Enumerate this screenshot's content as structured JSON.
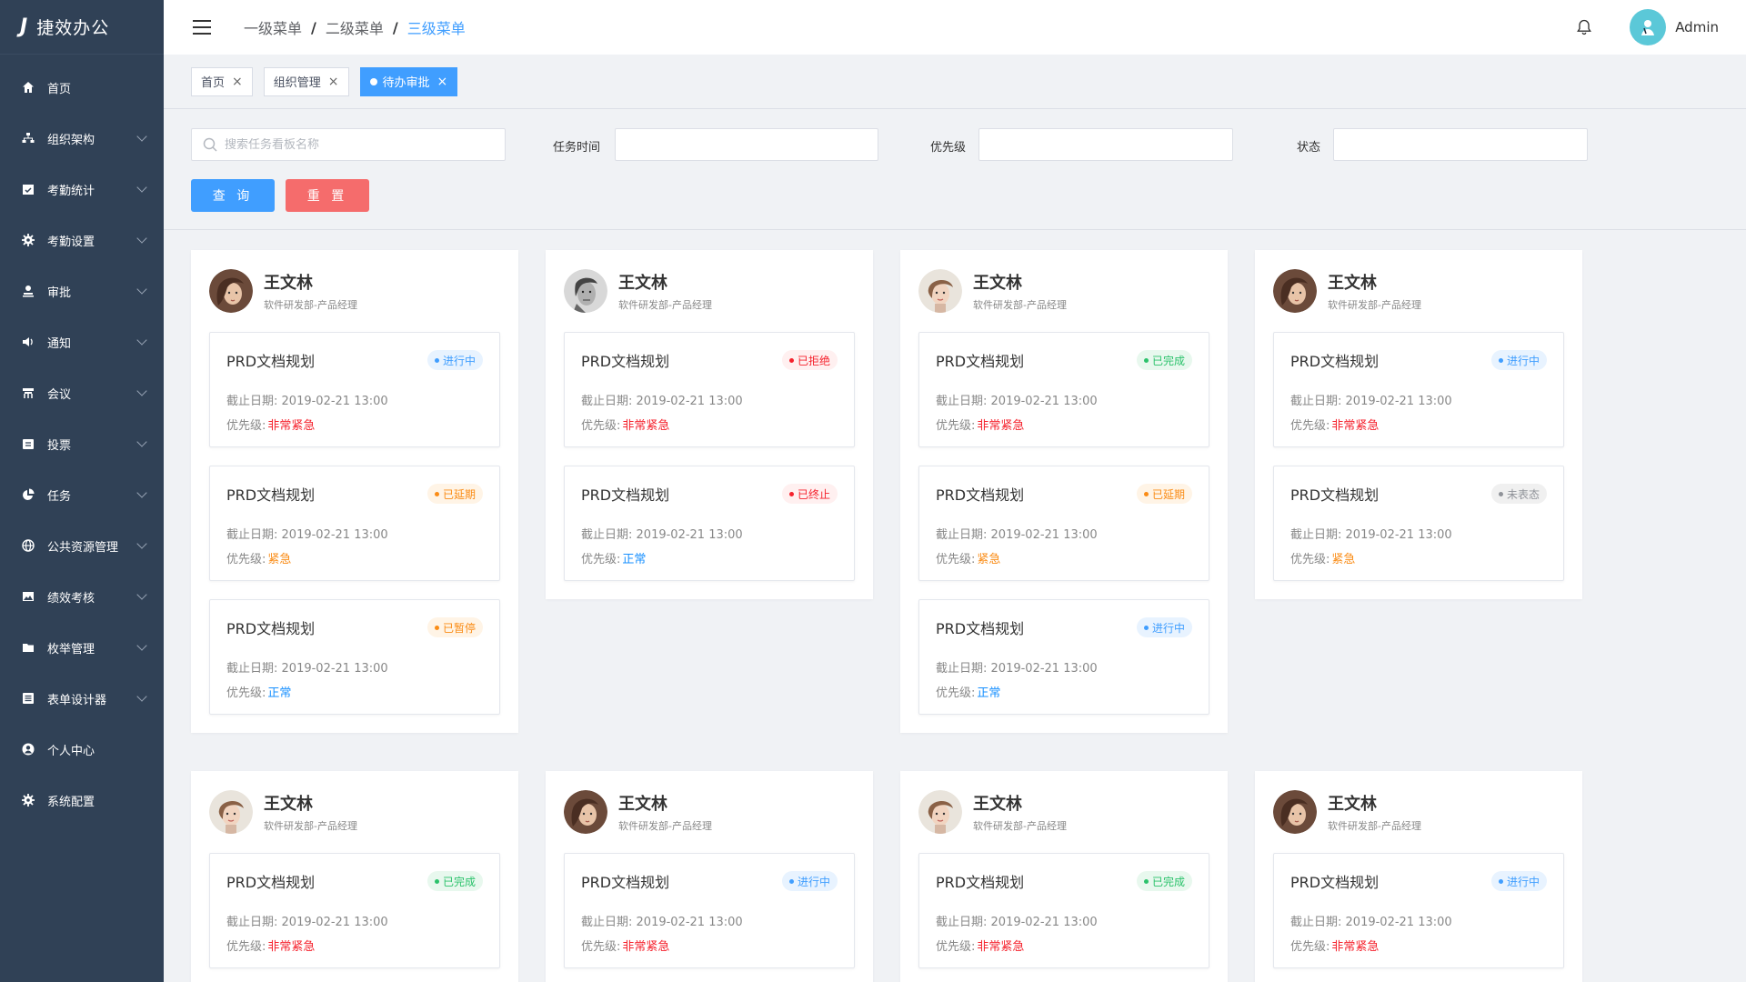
{
  "app": {
    "title": "捷效办公",
    "logo_mark": "J"
  },
  "sidebar": {
    "items": [
      {
        "label": "首页",
        "icon": "home-icon",
        "expandable": false
      },
      {
        "label": "组织架构",
        "icon": "org-icon",
        "expandable": true
      },
      {
        "label": "考勤统计",
        "icon": "calendar-check-icon",
        "expandable": true
      },
      {
        "label": "考勤设置",
        "icon": "gear-icon",
        "expandable": true
      },
      {
        "label": "审批",
        "icon": "stamp-icon",
        "expandable": true
      },
      {
        "label": "通知",
        "icon": "speaker-icon",
        "expandable": true
      },
      {
        "label": "会议",
        "icon": "meeting-icon",
        "expandable": true
      },
      {
        "label": "投票",
        "icon": "ballot-icon",
        "expandable": true
      },
      {
        "label": "任务",
        "icon": "pie-chart-icon",
        "expandable": true
      },
      {
        "label": "公共资源管理",
        "icon": "globe-icon",
        "expandable": true
      },
      {
        "label": "绩效考核",
        "icon": "image-icon",
        "expandable": true
      },
      {
        "label": "枚举管理",
        "icon": "folder-icon",
        "expandable": true
      },
      {
        "label": "表单设计器",
        "icon": "form-icon",
        "expandable": true
      },
      {
        "label": "个人中心",
        "icon": "user-icon",
        "expandable": false
      },
      {
        "label": "系统配置",
        "icon": "gear-icon",
        "expandable": false
      }
    ]
  },
  "header": {
    "breadcrumb": [
      "一级菜单",
      "二级菜单",
      "三级菜单"
    ],
    "user": "Admin"
  },
  "tags": [
    {
      "label": "首页",
      "active": false
    },
    {
      "label": "组织管理",
      "active": false
    },
    {
      "label": "待办审批",
      "active": true
    }
  ],
  "search": {
    "placeholder": "搜索任务看板名称",
    "time_label": "任务时间",
    "priority_label": "优先级",
    "status_label": "状态",
    "query_button": "查 询",
    "reset_button": "重 置"
  },
  "colors": {
    "sidebar_bg": "#304156",
    "primary": "#409eff",
    "danger": "#f56c6c",
    "urgent_red": "#f5222d",
    "urgent_orange": "#fa8c16",
    "normal_blue": "#1890ff"
  },
  "labels": {
    "deadline": "截止日期:",
    "priority": "优先级:"
  },
  "columns": [
    {
      "name": "王文林",
      "dept": "软件研发部-产品经理",
      "avatar": "woman-hair-avatar",
      "tasks": [
        {
          "title": "PRD文档规划",
          "status": "进行中",
          "status_type": "blue",
          "date": "2019-02-21  13:00",
          "priority": "非常紧急",
          "priority_type": "red"
        },
        {
          "title": "PRD文档规划",
          "status": "已延期",
          "status_type": "orange",
          "date": "2019-02-21  13:00",
          "priority": "紧急",
          "priority_type": "orange"
        },
        {
          "title": "PRD文档规划",
          "status": "已暂停",
          "status_type": "orange",
          "date": "2019-02-21  13:00",
          "priority": "正常",
          "priority_type": "blue"
        }
      ]
    },
    {
      "name": "王文林",
      "dept": "软件研发部-产品经理",
      "avatar": "man-bw-avatar",
      "tasks": [
        {
          "title": "PRD文档规划",
          "status": "已拒绝",
          "status_type": "red",
          "date": "2019-02-21  13:00",
          "priority": "非常紧急",
          "priority_type": "red"
        },
        {
          "title": "PRD文档规划",
          "status": "已终止",
          "status_type": "red",
          "date": "2019-02-21  13:00",
          "priority": "正常",
          "priority_type": "blue"
        }
      ]
    },
    {
      "name": "王文林",
      "dept": "软件研发部-产品经理",
      "avatar": "woman-light-avatar",
      "tasks": [
        {
          "title": "PRD文档规划",
          "status": "已完成",
          "status_type": "green",
          "date": "2019-02-21  13:00",
          "priority": "非常紧急",
          "priority_type": "red"
        },
        {
          "title": "PRD文档规划",
          "status": "已延期",
          "status_type": "orange",
          "date": "2019-02-21  13:00",
          "priority": "紧急",
          "priority_type": "orange"
        },
        {
          "title": "PRD文档规划",
          "status": "进行中",
          "status_type": "blue",
          "date": "2019-02-21  13:00",
          "priority": "正常",
          "priority_type": "blue"
        }
      ]
    },
    {
      "name": "王文林",
      "dept": "软件研发部-产品经理",
      "avatar": "woman-hair-avatar",
      "tasks": [
        {
          "title": "PRD文档规划",
          "status": "进行中",
          "status_type": "blue",
          "date": "2019-02-21  13:00",
          "priority": "非常紧急",
          "priority_type": "red"
        },
        {
          "title": "PRD文档规划",
          "status": "未表态",
          "status_type": "gray",
          "date": "2019-02-21  13:00",
          "priority": "紧急",
          "priority_type": "orange"
        }
      ]
    },
    {
      "name": "王文林",
      "dept": "软件研发部-产品经理",
      "avatar": "woman-light-avatar",
      "tasks": [
        {
          "title": "PRD文档规划",
          "status": "已完成",
          "status_type": "green",
          "date": "2019-02-21  13:00",
          "priority": "非常紧急",
          "priority_type": "red"
        }
      ]
    },
    {
      "name": "王文林",
      "dept": "软件研发部-产品经理",
      "avatar": "woman-hair-avatar",
      "tasks": [
        {
          "title": "PRD文档规划",
          "status": "进行中",
          "status_type": "blue",
          "date": "2019-02-21  13:00",
          "priority": "非常紧急",
          "priority_type": "red"
        }
      ]
    },
    {
      "name": "王文林",
      "dept": "软件研发部-产品经理",
      "avatar": "woman-light-avatar",
      "tasks": [
        {
          "title": "PRD文档规划",
          "status": "已完成",
          "status_type": "green",
          "date": "2019-02-21  13:00",
          "priority": "非常紧急",
          "priority_type": "red"
        }
      ]
    },
    {
      "name": "王文林",
      "dept": "软件研发部-产品经理",
      "avatar": "woman-hair-avatar",
      "tasks": [
        {
          "title": "PRD文档规划",
          "status": "进行中",
          "status_type": "blue",
          "date": "2019-02-21  13:00",
          "priority": "非常紧急",
          "priority_type": "red"
        }
      ]
    }
  ]
}
